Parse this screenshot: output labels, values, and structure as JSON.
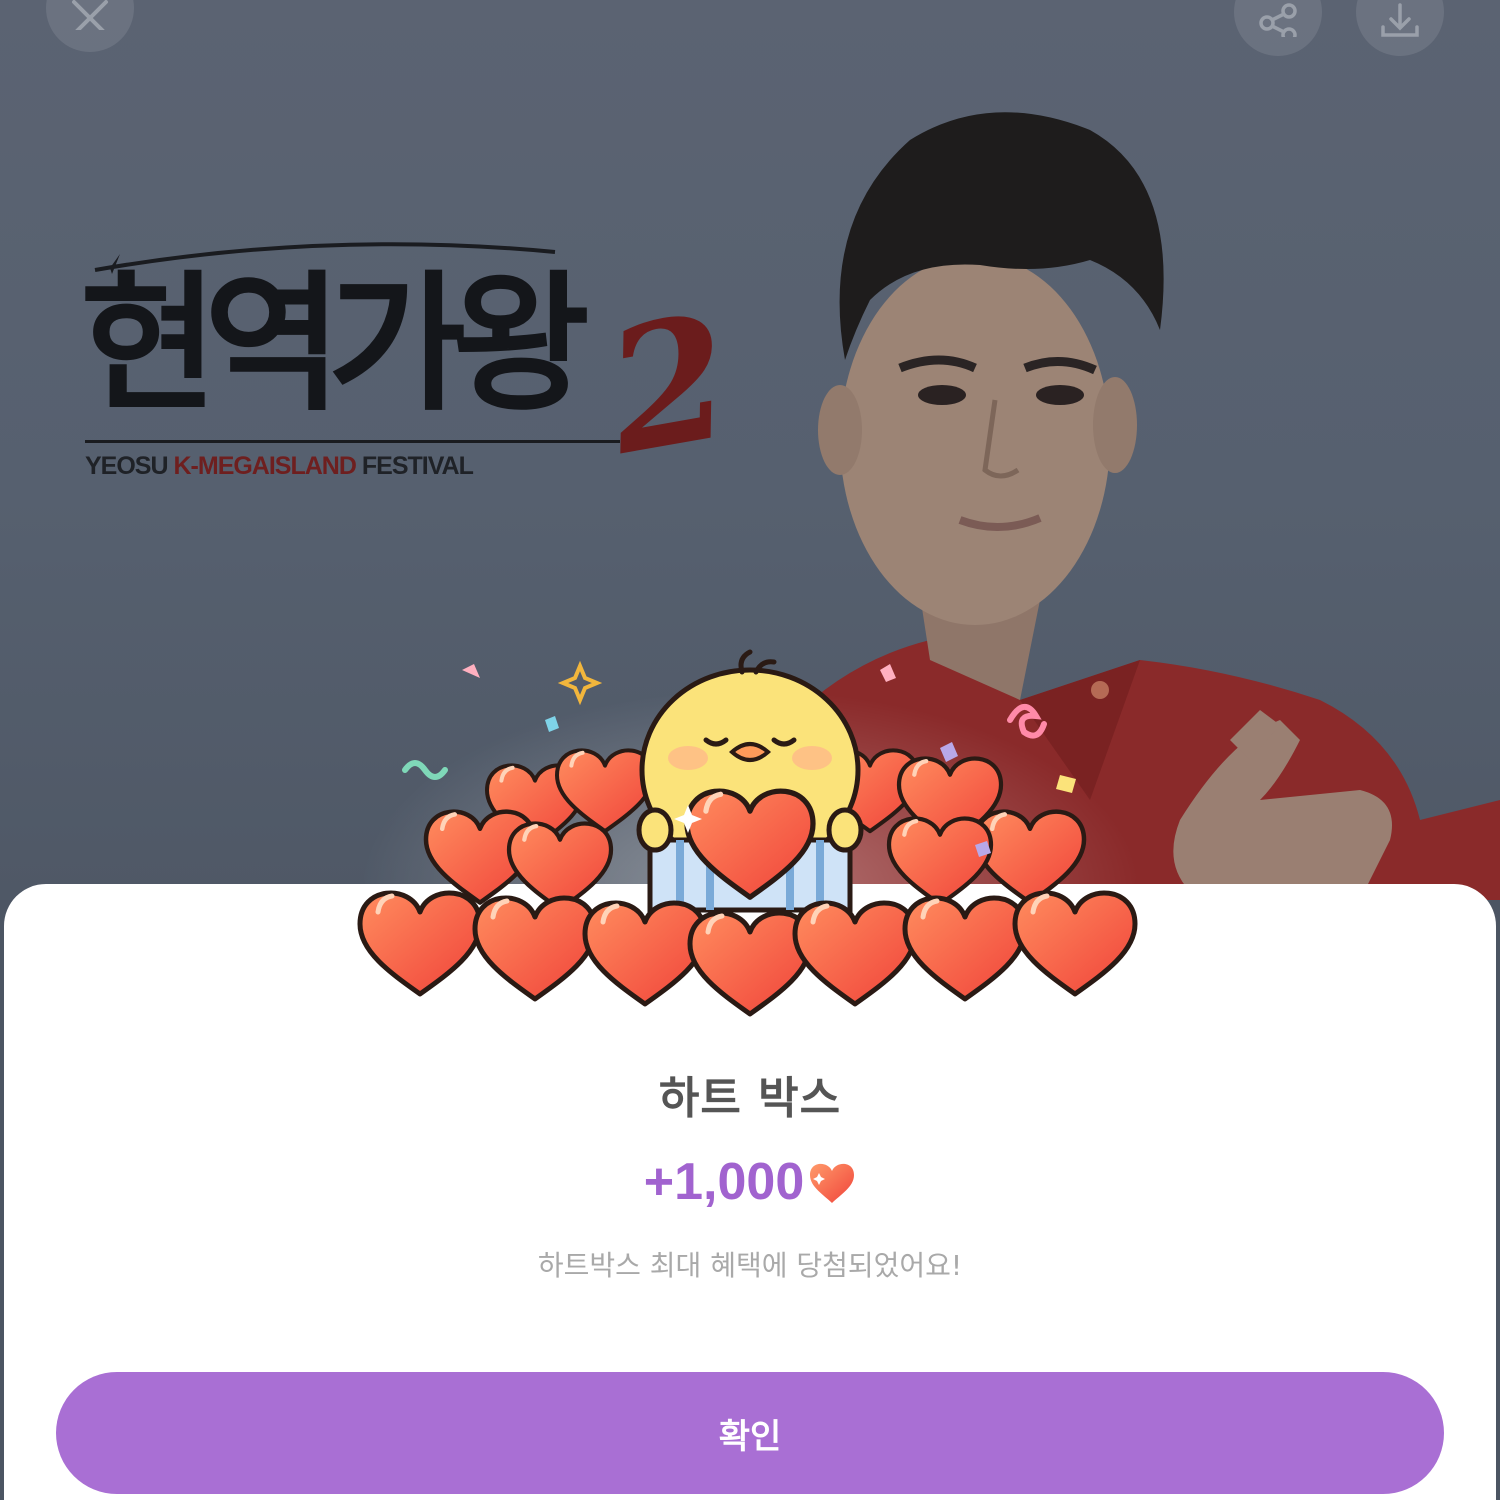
{
  "poster": {
    "title_ko": "현역가왕",
    "title_num": "2",
    "subtitle_a": "YEOSU ",
    "subtitle_b": "K-MEGAISLAND",
    "subtitle_c": " FESTIVAL"
  },
  "toolbar": {
    "close_icon": "close-icon",
    "share_icon": "share-icon",
    "download_icon": "download-icon"
  },
  "dialog": {
    "title": "하트 박스",
    "amount": "+1,000",
    "message": "하트박스 최대 혜택에 당첨되었어요!",
    "confirm_label": "확인"
  },
  "colors": {
    "accent": "#a96fd4",
    "amount": "#a163cf",
    "heart": "#f5563e"
  }
}
